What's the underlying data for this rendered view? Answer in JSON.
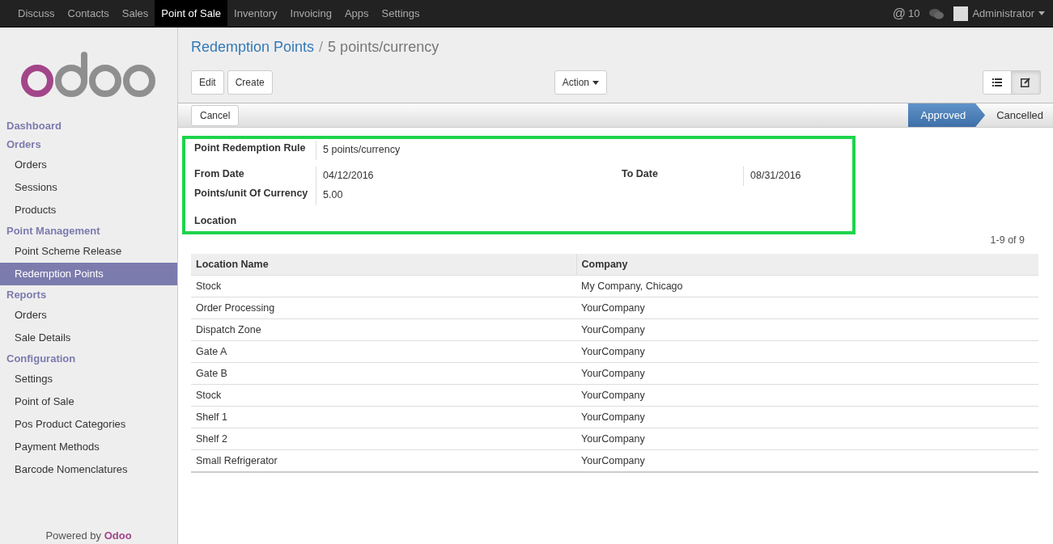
{
  "top_menu": [
    {
      "label": "Discuss",
      "selected": false
    },
    {
      "label": "Contacts",
      "selected": false
    },
    {
      "label": "Sales",
      "selected": false
    },
    {
      "label": "Point of Sale",
      "selected": true
    },
    {
      "label": "Inventory",
      "selected": false
    },
    {
      "label": "Invoicing",
      "selected": false
    },
    {
      "label": "Apps",
      "selected": false
    },
    {
      "label": "Settings",
      "selected": false
    }
  ],
  "mentions": {
    "symbol": "@",
    "count": "10"
  },
  "user": {
    "name": "Administrator"
  },
  "sidebar": [
    {
      "title": "Dashboard"
    },
    {
      "title": "Orders",
      "items": [
        {
          "label": "Orders",
          "selected": false
        },
        {
          "label": "Sessions",
          "selected": false
        },
        {
          "label": "Products",
          "selected": false
        }
      ]
    },
    {
      "title": "Point Management",
      "items": [
        {
          "label": "Point Scheme Release",
          "selected": false
        },
        {
          "label": "Redemption Points",
          "selected": true
        }
      ]
    },
    {
      "title": "Reports",
      "items": [
        {
          "label": "Orders",
          "selected": false
        },
        {
          "label": "Sale Details",
          "selected": false
        }
      ]
    },
    {
      "title": "Configuration",
      "items": [
        {
          "label": "Settings",
          "selected": false
        },
        {
          "label": "Point of Sale",
          "selected": false
        },
        {
          "label": "Pos Product Categories",
          "selected": false
        },
        {
          "label": "Payment Methods",
          "selected": false
        },
        {
          "label": "Barcode Nomenclatures",
          "selected": false
        }
      ]
    }
  ],
  "footer": {
    "prefix": "Powered by",
    "brand": "Odoo"
  },
  "breadcrumb": {
    "parent": "Redemption Points",
    "separator": "/",
    "current": "5 points/currency"
  },
  "buttons": [
    "Edit",
    "Create"
  ],
  "action": "Action",
  "view_switcher": [
    {
      "kind": "list",
      "selected": false
    },
    {
      "kind": "form",
      "selected": true
    }
  ],
  "status_buttons": [
    "Cancel"
  ],
  "stages": [
    {
      "label": "Approved",
      "selected": true
    },
    {
      "label": "Cancelled",
      "selected": false
    }
  ],
  "form": {
    "rule": {
      "label": "Point Redemption Rule",
      "value": "5 points/currency"
    },
    "from_date": {
      "label": "From Date",
      "value": "04/12/2016"
    },
    "to_date": {
      "label": "To Date",
      "value": "08/31/2016"
    },
    "points": {
      "label": "Points/unit Of Currency",
      "value": "5.00"
    },
    "location": {
      "label": "Location"
    }
  },
  "pager": "1-9 of 9",
  "table": {
    "columns": [
      "Location Name",
      "Company"
    ],
    "rows": [
      [
        "Stock",
        "My Company, Chicago"
      ],
      [
        "Order Processing",
        "YourCompany"
      ],
      [
        "Dispatch Zone",
        "YourCompany"
      ],
      [
        "Gate A",
        "YourCompany"
      ],
      [
        "Gate B",
        "YourCompany"
      ],
      [
        "Stock",
        "YourCompany"
      ],
      [
        "Shelf 1",
        "YourCompany"
      ],
      [
        "Shelf 2",
        "YourCompany"
      ],
      [
        "Small Refrigerator",
        "YourCompany"
      ]
    ]
  }
}
